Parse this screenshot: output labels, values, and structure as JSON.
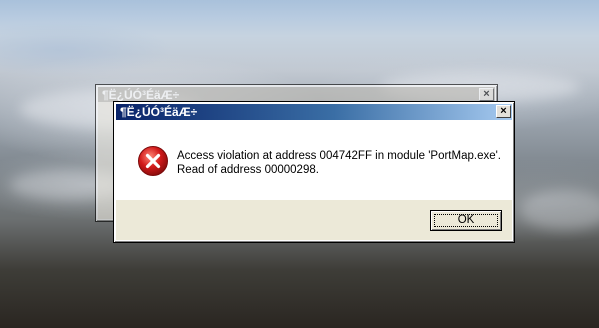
{
  "desktop": {
    "wallpaper": "earth-from-orbit"
  },
  "background_dialog": {
    "title": "¶Ë¿ÚÓ³ÉäÆ÷",
    "close_glyph": "×"
  },
  "dialog": {
    "title": "¶Ë¿ÚÓ³ÉäÆ÷",
    "close_glyph": "×",
    "icon": "error-icon",
    "message_line1": "Access violation at address 004742FF in module 'PortMap.exe'.",
    "message_line2": "Read of address 00000298.",
    "ok_label": "OK"
  },
  "colors": {
    "title_active_start": "#0a246a",
    "title_active_end": "#a6caf0",
    "title_inactive": "#bdbab3",
    "error_red": "#d21a1a",
    "button_face": "#ece9d8"
  }
}
